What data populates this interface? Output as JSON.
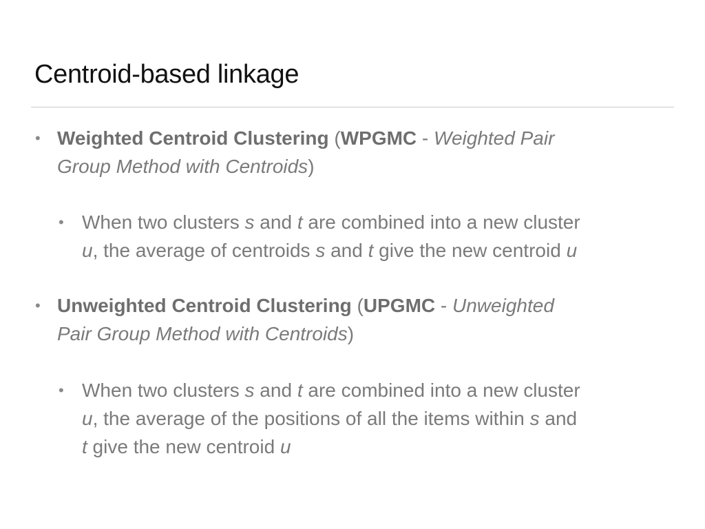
{
  "slide": {
    "title": "Centroid-based linkage"
  },
  "bullets": [
    {
      "strong": "Weighted Centroid Clustering",
      "paren_open": " (",
      "abbr": "WPGMC",
      "dash": " - ",
      "expansion_line1": "Weighted Pair",
      "expansion_line2": "Group Method with Centroids",
      "paren_close": ")",
      "sub": {
        "line1_a": "When two clusters ",
        "s1": "s",
        "line1_b": " and ",
        "t1": "t",
        "line1_c": " are combined into a new cluster",
        "u1": "u",
        "line2_a": ", the average of centroids ",
        "s2": "s",
        "line2_b": " and ",
        "t2": "t",
        "line2_c": " give the new centroid ",
        "u2": "u"
      }
    },
    {
      "strong": "Unweighted Centroid Clustering",
      "paren_open": " (",
      "abbr": "UPGMC",
      "dash": " - ",
      "expansion_line1": "Unweighted",
      "expansion_line2": "Pair Group Method with Centroids",
      "paren_close": ")",
      "sub": {
        "line1_a": "When two clusters ",
        "s1": "s",
        "line1_b": " and ",
        "t1": "t",
        "line1_c": " are combined into a new cluster",
        "u1": "u",
        "line2_a": ", the average of the positions of all the items within ",
        "s2": "s",
        "line2_b": " and",
        "t2": "t",
        "line3_a": " give the new centroid ",
        "u2": "u"
      }
    }
  ],
  "bullet_glyph": "•"
}
